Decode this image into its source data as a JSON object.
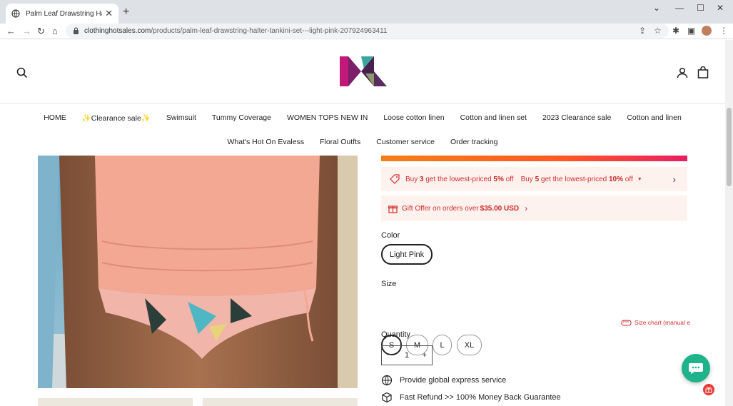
{
  "browser": {
    "tab_title": "Palm Leaf Drawstring Halter Tankini",
    "url_host": "clothinghotsales.com",
    "url_path": "/products/palm-leaf-drawstring-halter-tankini-set---light-pink-207924963411"
  },
  "nav": {
    "row1": [
      "HOME",
      "✨Clearance sale✨",
      "Swimsuit",
      "Tummy Coverage",
      "WOMEN TOPS NEW IN",
      "Loose cotton linen",
      "Cotton and linen set",
      "2023 Clearance sale",
      "Cotton and linen"
    ],
    "row2": [
      "What's Hot On Evaless",
      "Floral Outfts",
      "Customer service",
      "Order tracking"
    ]
  },
  "promo": {
    "p1_pre": "Buy ",
    "p1_qty": "3",
    "p1_mid": " get the lowest-priced ",
    "p1_pct": "5%",
    "p1_post": " off",
    "p2_pre": "Buy ",
    "p2_qty": "5",
    "p2_mid": " get the lowest-priced ",
    "p2_pct": "10%",
    "p2_post": " off",
    "gift_pre": "Gift Offer on orders over ",
    "gift_amount": "$35.00 USD"
  },
  "color": {
    "label": "Color",
    "selected": "Light Pink"
  },
  "size": {
    "label": "Size",
    "options": [
      "S",
      "M",
      "L",
      "XL"
    ],
    "selected": "S",
    "chart_link": "Size chart (manual e"
  },
  "quantity": {
    "label": "Quantity",
    "value": "1",
    "minus": "−",
    "plus": "+"
  },
  "features": [
    "Provide global express service",
    "Fast Refund >> 100% Money Back Guarantee"
  ],
  "colors": {
    "accent_red": "#d32f2f",
    "promo_bg": "#fdf2ee",
    "chat_green": "#1eb389"
  }
}
